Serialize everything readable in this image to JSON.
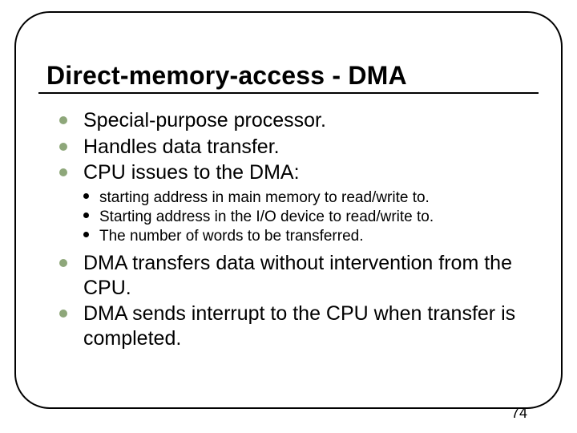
{
  "title": "Direct-memory-access - DMA",
  "bullets": {
    "b1": "Special-purpose processor.",
    "b2": "Handles data transfer.",
    "b3": "CPU issues to the DMA:",
    "b3_sub": {
      "s1": "starting address in main memory to read/write to.",
      "s2": "Starting address in the I/O device to read/write to.",
      "s3": "The number of words to be transferred."
    },
    "b4": "DMA transfers data without intervention from the CPU.",
    "b5": "DMA sends interrupt to the CPU when transfer is completed."
  },
  "page_number": "74"
}
